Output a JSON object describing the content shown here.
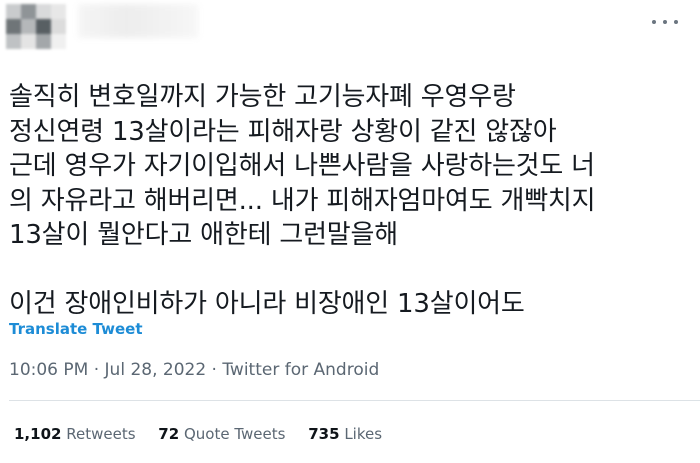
{
  "tweet": {
    "avatar": {
      "colors": [
        "#c9cbcd",
        "#8f9497",
        "#d9dadb",
        "#e7e7e7",
        "#6f7578",
        "#b5b8ba",
        "#585f63",
        "#dcdcdc",
        "#bfc2c4",
        "#e4e4e4",
        "#a3a7aa",
        "#f0f0f0"
      ]
    },
    "text_lines": [
      "솔직히 변호일까지 가능한 고기능자폐 우영우랑",
      "정신연령 13살이라는 피해자랑 상황이 같진 않잖아",
      "근데 영우가 자기이입해서 나쁜사람을 사랑하는것도 너",
      "의 자유라고 해버리면... 내가 피해자엄마여도 개빡치지",
      "13살이 뭘안다고 애한테 그런말을해",
      "",
      "이건 장애인비하가 아니라 비장애인 13살이어도"
    ],
    "translate_label": "Translate Tweet",
    "timestamp": "10:06 PM · Jul 28, 2022 · Twitter for Android",
    "stats": {
      "retweets_count": "1,102",
      "retweets_label": "Retweets",
      "quotes_count": "72",
      "quotes_label": "Quote Tweets",
      "likes_count": "735",
      "likes_label": "Likes"
    }
  }
}
